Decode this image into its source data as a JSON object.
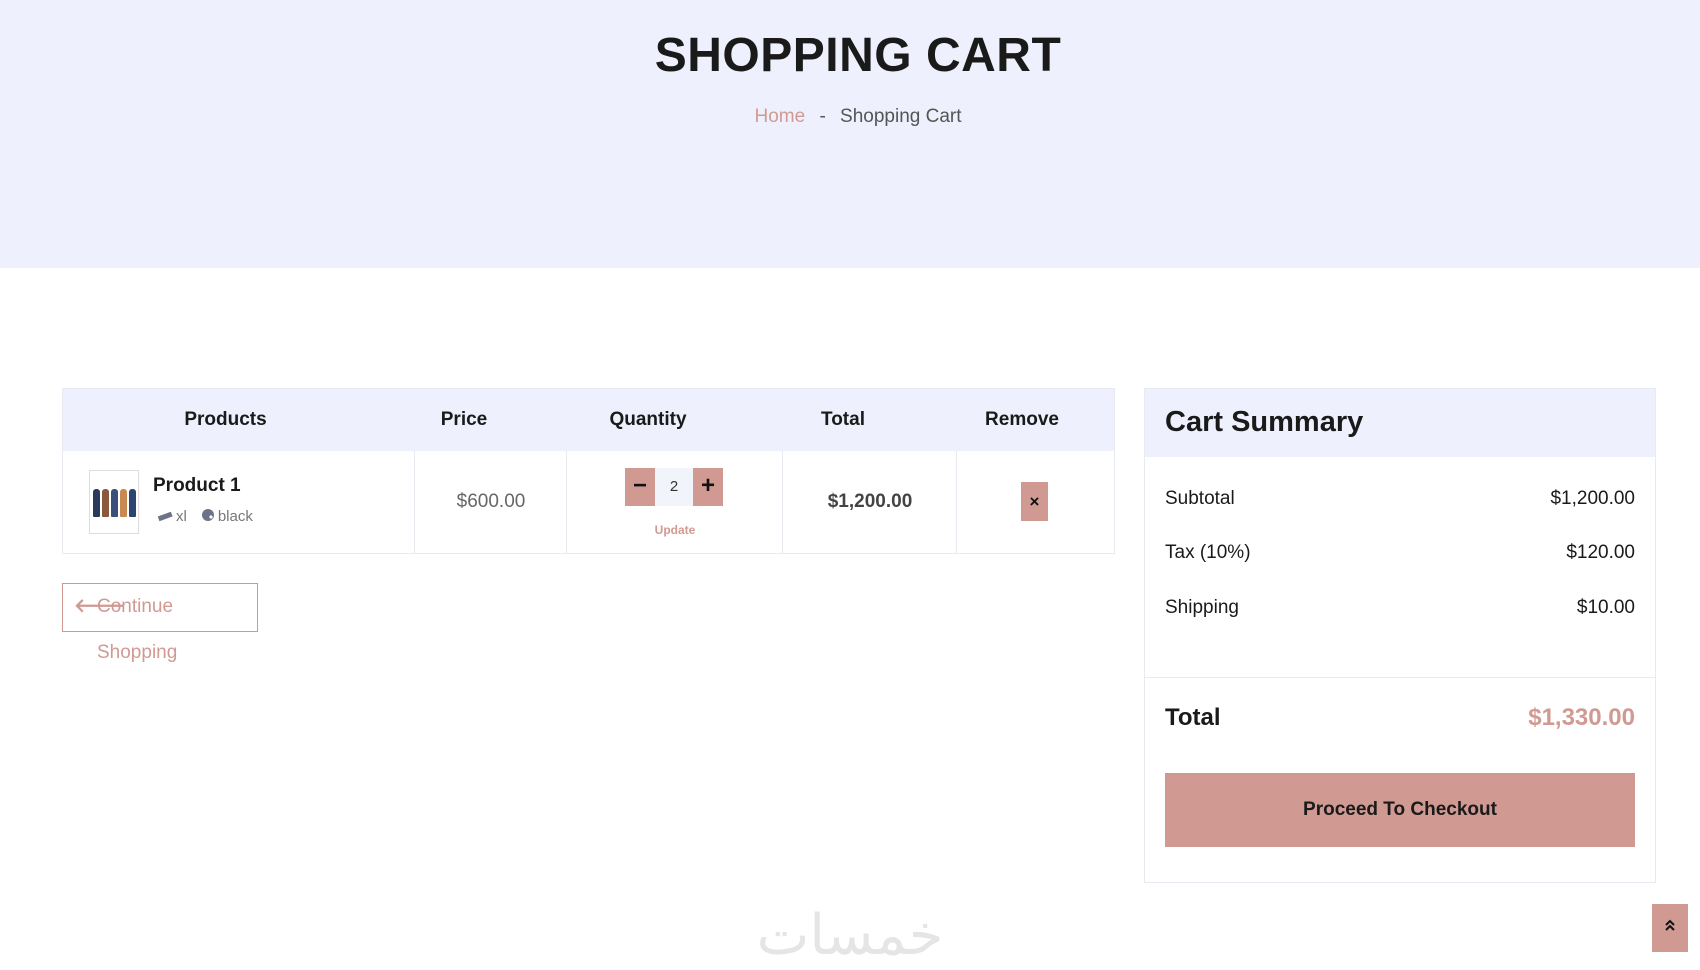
{
  "page": {
    "title": "SHOPPING CART",
    "breadcrumb": {
      "home": "Home",
      "separator": "-",
      "current": "Shopping Cart"
    }
  },
  "cart": {
    "headers": {
      "products": "Products",
      "price": "Price",
      "quantity": "Quantity",
      "total": "Total",
      "remove": "Remove"
    },
    "items": [
      {
        "name": "Product 1",
        "size": "xl",
        "color": "black",
        "price": "$600.00",
        "quantity": "2",
        "total": "$1,200.00",
        "update_label": "Update",
        "decrement_label": "−",
        "increment_label": "+",
        "remove_label": "×"
      }
    ],
    "continue_label": "Continue Shopping"
  },
  "summary": {
    "title": "Cart Summary",
    "subtotal_label": "Subtotal",
    "subtotal": "$1,200.00",
    "tax_label": "Tax (10%)",
    "tax": "$120.00",
    "shipping_label": "Shipping",
    "shipping": "$10.00",
    "total_label": "Total",
    "total": "$1,330.00",
    "checkout_label": "Proceed To Checkout"
  },
  "watermark": "خمسات",
  "icons": {
    "size": "ruler-icon",
    "color": "palette-icon",
    "continue": "arrow-left-icon",
    "scroll_top": "double-chevron-up-icon"
  },
  "colors": {
    "accent": "#d09a93",
    "hero_bg": "#eef1fd",
    "text": "#1a1a1a"
  }
}
